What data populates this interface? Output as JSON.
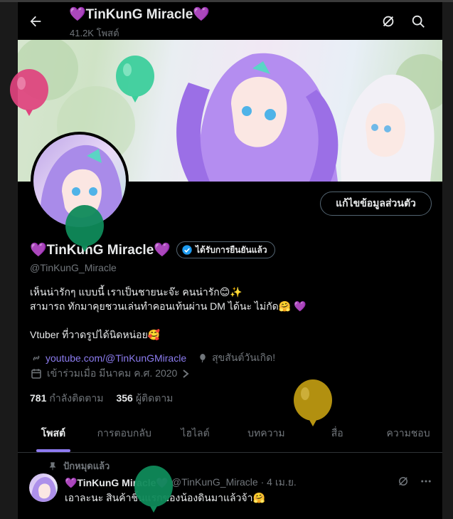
{
  "header": {
    "title": "💜TinKunG Miracle💜",
    "posts_count": "41.2K โพสต์"
  },
  "profile": {
    "name": "💜TinKunG Miracle💜",
    "verified_label": "ได้รับการยืนยันแล้ว",
    "handle": "@TinKunG_Miracle",
    "edit_button": "แก้ไขข้อมูลส่วนตัว",
    "bio": [
      "เห็นน่ารักๆ แบบนี้ เราเป็นชายนะจ๊ะ คนน่ารัก😊✨",
      "สามารถ ทักมาคุยชวนเล่นทำคอนเท้นผ่าน DM ได้นะ ไม่กัด🤗 💜",
      "",
      "Vtuber ที่วาดรูปได้นิดหน่อย🥰"
    ],
    "link": "youtube.com/@TinKunGMiracle",
    "birthday": "สุขสันต์วันเกิด!",
    "joined": "เข้าร่วมเมื่อ มีนาคม ค.ศ. 2020",
    "following_count": "781",
    "following_label": "กำลังติดตาม",
    "followers_count": "356",
    "followers_label": "ผู้ติดตาม"
  },
  "tabs": [
    "โพสต์",
    "การตอบกลับ",
    "ไฮไลต์",
    "บทความ",
    "สื่อ",
    "ความชอบ"
  ],
  "pinned_label": "ปักหมุดแล้ว",
  "tweet": {
    "name": "💜TinKunG Miracle💜",
    "handle_time": "@TinKunG_Miracle · 4 เม.ย.",
    "text": "เอาละนะ สินค้าชิ้นแรกของน้องดินมาแล้วจ้า🤗"
  },
  "colors": {
    "accent": "#8e7bf0",
    "background": "#000000",
    "muted": "#71767b",
    "verified_badge": "#1d9bf0"
  }
}
